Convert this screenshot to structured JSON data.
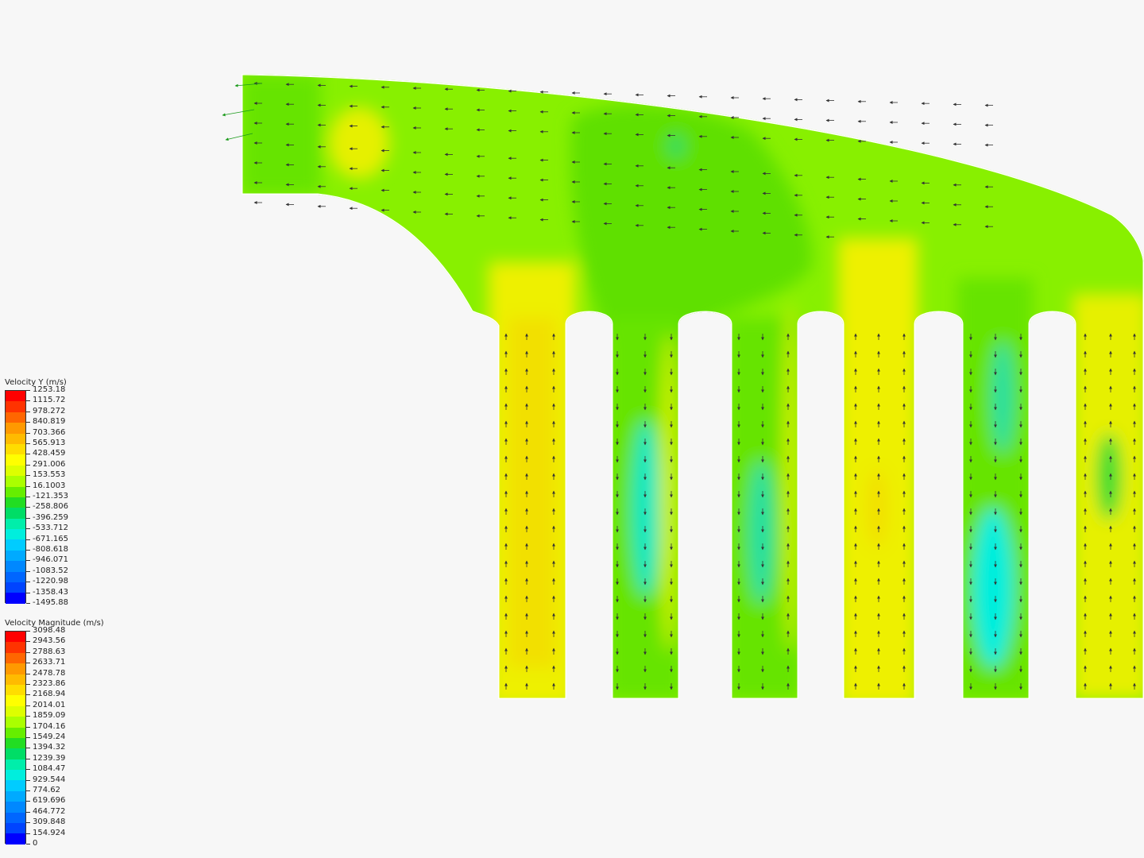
{
  "legends": [
    {
      "id": "velocity-y",
      "title": "Velocity Y (m/s)",
      "labels": [
        "1253.18",
        "1115.72",
        "978.272",
        "840.819",
        "703.366",
        "565.913",
        "428.459",
        "291.006",
        "153.553",
        "16.1003",
        "-121.353",
        "-258.806",
        "-396.259",
        "-533.712",
        "-671.165",
        "-808.618",
        "-946.071",
        "-1083.52",
        "-1220.98",
        "-1358.43",
        "-1495.88"
      ],
      "colors": [
        "#ff0000",
        "#ff3300",
        "#ff6600",
        "#ff9900",
        "#ffbb00",
        "#ffdd00",
        "#ffff00",
        "#ddff00",
        "#aaff00",
        "#66ee00",
        "#22dd22",
        "#00dd66",
        "#00eeaa",
        "#00eedd",
        "#00ccff",
        "#00aaff",
        "#0088ff",
        "#0066ff",
        "#0044ff",
        "#0000ff"
      ]
    },
    {
      "id": "velocity-magnitude",
      "title": "Velocity Magnitude (m/s)",
      "labels": [
        "3098.48",
        "2943.56",
        "2788.63",
        "2633.71",
        "2478.78",
        "2323.86",
        "2168.94",
        "2014.01",
        "1859.09",
        "1704.16",
        "1549.24",
        "1394.32",
        "1239.39",
        "1084.47",
        "929.544",
        "774.62",
        "619.696",
        "464.772",
        "309.848",
        "154.924",
        "0"
      ],
      "colors": [
        "#ff0000",
        "#ff3300",
        "#ff6600",
        "#ff9900",
        "#ffbb00",
        "#ffdd00",
        "#ffff00",
        "#ddff00",
        "#aaff00",
        "#66ee00",
        "#22dd22",
        "#00dd66",
        "#00eeaa",
        "#00eedd",
        "#00ccff",
        "#00aaff",
        "#0088ff",
        "#0066ff",
        "#0044ff",
        "#0000ff"
      ]
    }
  ],
  "colors": {
    "background": "#f7f7f7",
    "field_green": "#66e400",
    "field_lime": "#88f000",
    "field_yellow": "#e6f000",
    "field_gold": "#f2e000",
    "field_cyan": "#00e8c0",
    "arrow": "#333333",
    "inlet_arrow": "#1a9a1a"
  }
}
